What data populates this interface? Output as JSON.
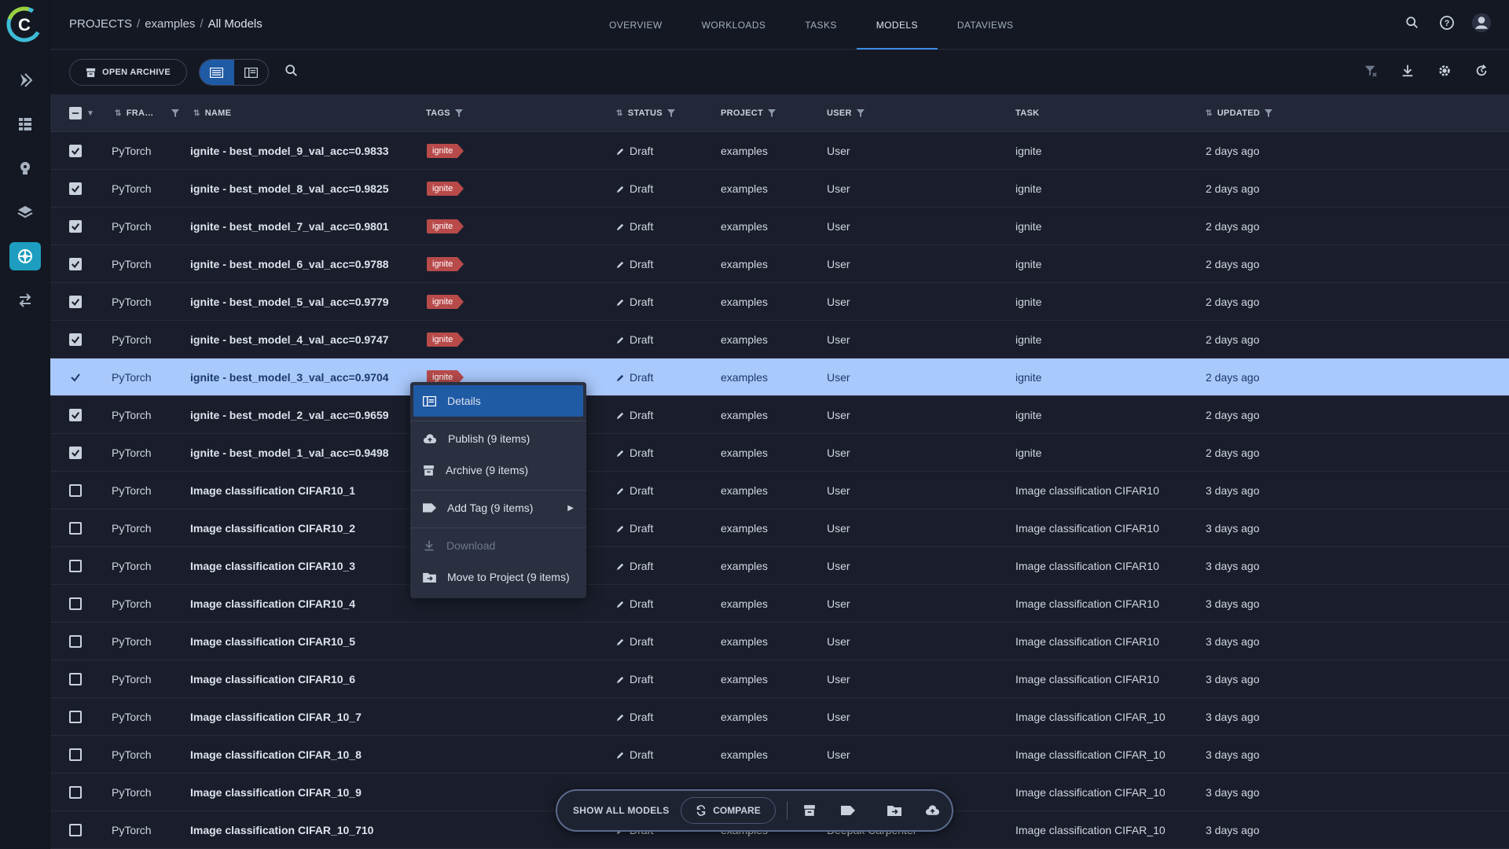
{
  "breadcrumb": {
    "root": "PROJECTS",
    "project": "examples",
    "current": "All Models"
  },
  "tabs": [
    "OVERVIEW",
    "WORKLOADS",
    "TASKS",
    "MODELS",
    "DATAVIEWS"
  ],
  "active_tab": "MODELS",
  "toolbar": {
    "open_archive_label": "OPEN ARCHIVE"
  },
  "columns": {
    "framework": "FRA…",
    "name": "NAME",
    "tags": "TAGS",
    "status": "STATUS",
    "project": "PROJECT",
    "user": "USER",
    "task": "TASK",
    "updated": "UPDATED"
  },
  "rows": [
    {
      "checked": true,
      "framework": "PyTorch",
      "name": "ignite - best_model_9_val_acc=0.9833",
      "tag": "ignite",
      "status": "Draft",
      "project": "examples",
      "user": "User",
      "task": "ignite",
      "updated": "2 days ago"
    },
    {
      "checked": true,
      "framework": "PyTorch",
      "name": "ignite - best_model_8_val_acc=0.9825",
      "tag": "ignite",
      "status": "Draft",
      "project": "examples",
      "user": "User",
      "task": "ignite",
      "updated": "2 days ago"
    },
    {
      "checked": true,
      "framework": "PyTorch",
      "name": "ignite - best_model_7_val_acc=0.9801",
      "tag": "ignite",
      "status": "Draft",
      "project": "examples",
      "user": "User",
      "task": "ignite",
      "updated": "2 days ago"
    },
    {
      "checked": true,
      "framework": "PyTorch",
      "name": "ignite - best_model_6_val_acc=0.9788",
      "tag": "ignite",
      "status": "Draft",
      "project": "examples",
      "user": "User",
      "task": "ignite",
      "updated": "2 days ago"
    },
    {
      "checked": true,
      "framework": "PyTorch",
      "name": "ignite - best_model_5_val_acc=0.9779",
      "tag": "ignite",
      "status": "Draft",
      "project": "examples",
      "user": "User",
      "task": "ignite",
      "updated": "2 days ago"
    },
    {
      "checked": true,
      "framework": "PyTorch",
      "name": "ignite - best_model_4_val_acc=0.9747",
      "tag": "ignite",
      "status": "Draft",
      "project": "examples",
      "user": "User",
      "task": "ignite",
      "updated": "2 days ago"
    },
    {
      "checked": true,
      "selected": true,
      "framework": "PyTorch",
      "name": "ignite - best_model_3_val_acc=0.9704",
      "tag": "ignite",
      "status": "Draft",
      "project": "examples",
      "user": "User",
      "task": "ignite",
      "updated": "2 days ago"
    },
    {
      "checked": true,
      "framework": "PyTorch",
      "name": "ignite - best_model_2_val_acc=0.9659",
      "tag": "",
      "status": "Draft",
      "project": "examples",
      "user": "User",
      "task": "ignite",
      "updated": "2 days ago"
    },
    {
      "checked": true,
      "framework": "PyTorch",
      "name": "ignite - best_model_1_val_acc=0.9498",
      "tag": "",
      "status": "Draft",
      "project": "examples",
      "user": "User",
      "task": "ignite",
      "updated": "2 days ago"
    },
    {
      "checked": false,
      "framework": "PyTorch",
      "name": "Image classification CIFAR10_1",
      "tag": "",
      "status": "Draft",
      "project": "examples",
      "user": "User",
      "task": "Image classification CIFAR10",
      "updated": "3 days ago"
    },
    {
      "checked": false,
      "framework": "PyTorch",
      "name": "Image classification CIFAR10_2",
      "tag": "",
      "status": "Draft",
      "project": "examples",
      "user": "User",
      "task": "Image classification CIFAR10",
      "updated": "3 days ago"
    },
    {
      "checked": false,
      "framework": "PyTorch",
      "name": "Image classification CIFAR10_3",
      "tag": "",
      "status": "Draft",
      "project": "examples",
      "user": "User",
      "task": "Image classification CIFAR10",
      "updated": "3 days ago"
    },
    {
      "checked": false,
      "framework": "PyTorch",
      "name": "Image classification CIFAR10_4",
      "tag": "",
      "status": "Draft",
      "project": "examples",
      "user": "User",
      "task": "Image classification CIFAR10",
      "updated": "3 days ago"
    },
    {
      "checked": false,
      "framework": "PyTorch",
      "name": "Image classification CIFAR10_5",
      "tag": "",
      "status": "Draft",
      "project": "examples",
      "user": "User",
      "task": "Image classification CIFAR10",
      "updated": "3 days ago"
    },
    {
      "checked": false,
      "framework": "PyTorch",
      "name": "Image classification CIFAR10_6",
      "tag": "",
      "status": "Draft",
      "project": "examples",
      "user": "User",
      "task": "Image classification CIFAR10",
      "updated": "3 days ago"
    },
    {
      "checked": false,
      "framework": "PyTorch",
      "name": "Image classification CIFAR_10_7",
      "tag": "",
      "status": "Draft",
      "project": "examples",
      "user": "User",
      "task": "Image classification CIFAR_10",
      "updated": "3 days ago"
    },
    {
      "checked": false,
      "framework": "PyTorch",
      "name": "Image classification CIFAR_10_8",
      "tag": "",
      "status": "Draft",
      "project": "examples",
      "user": "User",
      "task": "Image classification CIFAR_10",
      "updated": "3 days ago"
    },
    {
      "checked": false,
      "framework": "PyTorch",
      "name": "Image classification CIFAR_10_9",
      "tag": "",
      "status": "",
      "project": "",
      "user": "",
      "task": "Image classification CIFAR_10",
      "updated": "3 days ago"
    },
    {
      "checked": false,
      "framework": "PyTorch",
      "name": "Image classification CIFAR_10_710",
      "tag": "",
      "status": "Draft",
      "project": "examples",
      "user": "Deepak Carpenter",
      "task": "Image classification CIFAR_10",
      "updated": "3 days ago"
    }
  ],
  "context_menu": {
    "details": "Details",
    "publish": "Publish (9 items)",
    "archive": "Archive (9 items)",
    "add_tag": "Add Tag (9 items)",
    "download": "Download",
    "move": "Move to Project (9 items)"
  },
  "footer_bar": {
    "show_all": "SHOW ALL MODELS",
    "compare": "COMPARE"
  },
  "colors": {
    "accent": "#1f5aa5",
    "selected_row": "#a9c8fb",
    "tag": "#b84a4a"
  }
}
